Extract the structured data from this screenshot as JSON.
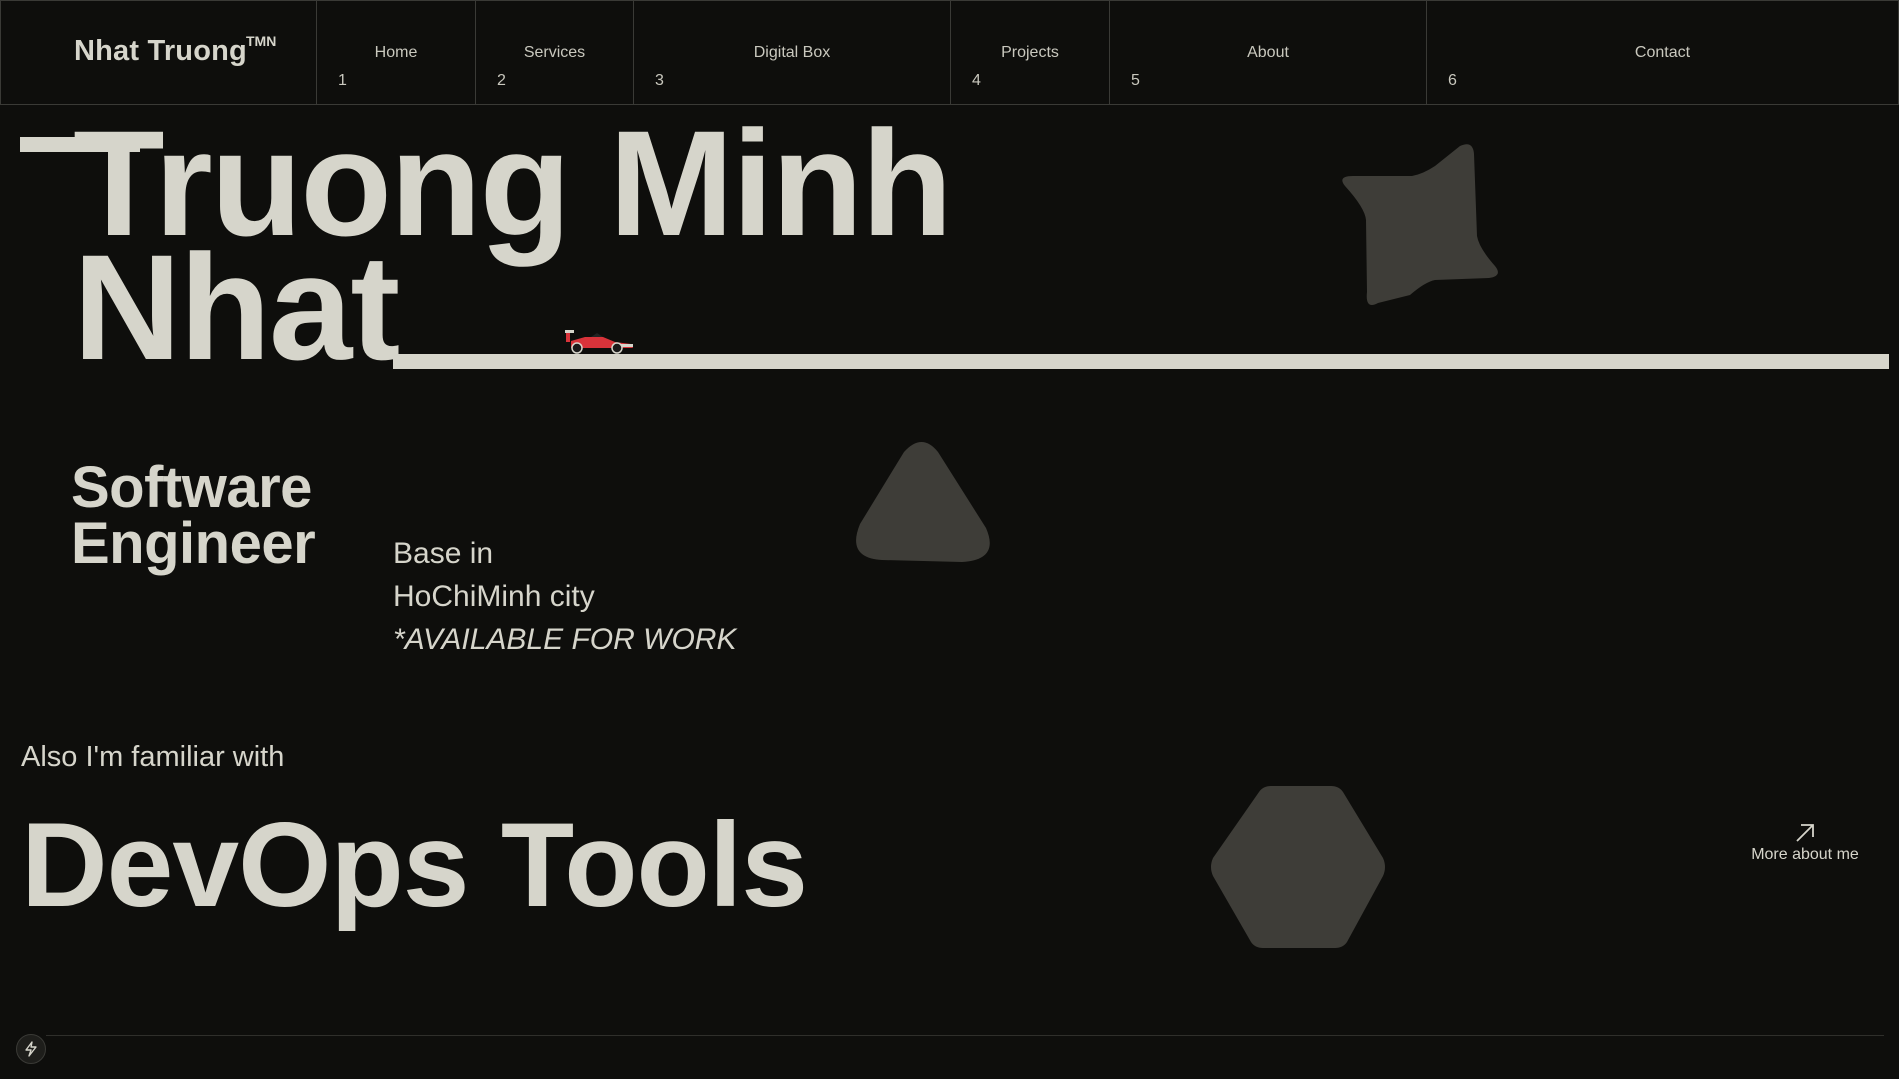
{
  "brand": {
    "name": "Nhat Truong",
    "sup": "TMN"
  },
  "nav": [
    {
      "label": "Home",
      "num": "1"
    },
    {
      "label": "Services",
      "num": "2"
    },
    {
      "label": "Digital Box",
      "num": "3"
    },
    {
      "label": "Projects",
      "num": "4"
    },
    {
      "label": "About",
      "num": "5"
    },
    {
      "label": "Contact",
      "num": "6"
    }
  ],
  "hero": {
    "line1": "Truong Minh",
    "line2": "Nhat"
  },
  "role": {
    "line1": "Software",
    "line2": "Engineer"
  },
  "location": {
    "line1": "Base in",
    "line2": "HoChiMinh city",
    "status": "*AVAILABLE FOR WORK"
  },
  "skills": {
    "intro": "Also I'm familiar with",
    "headline": "DevOps Tools"
  },
  "more_link": {
    "label": "More about me",
    "icon": "arrow-up-right-icon"
  },
  "colors": {
    "background": "#0e0e0c",
    "text": "#d6d5cb",
    "shape": "#3e3d38",
    "car": "#d8333a"
  },
  "icons": [
    "star-shape",
    "triangle-shape",
    "hexagon-shape",
    "race-car-icon",
    "bolt-icon"
  ]
}
